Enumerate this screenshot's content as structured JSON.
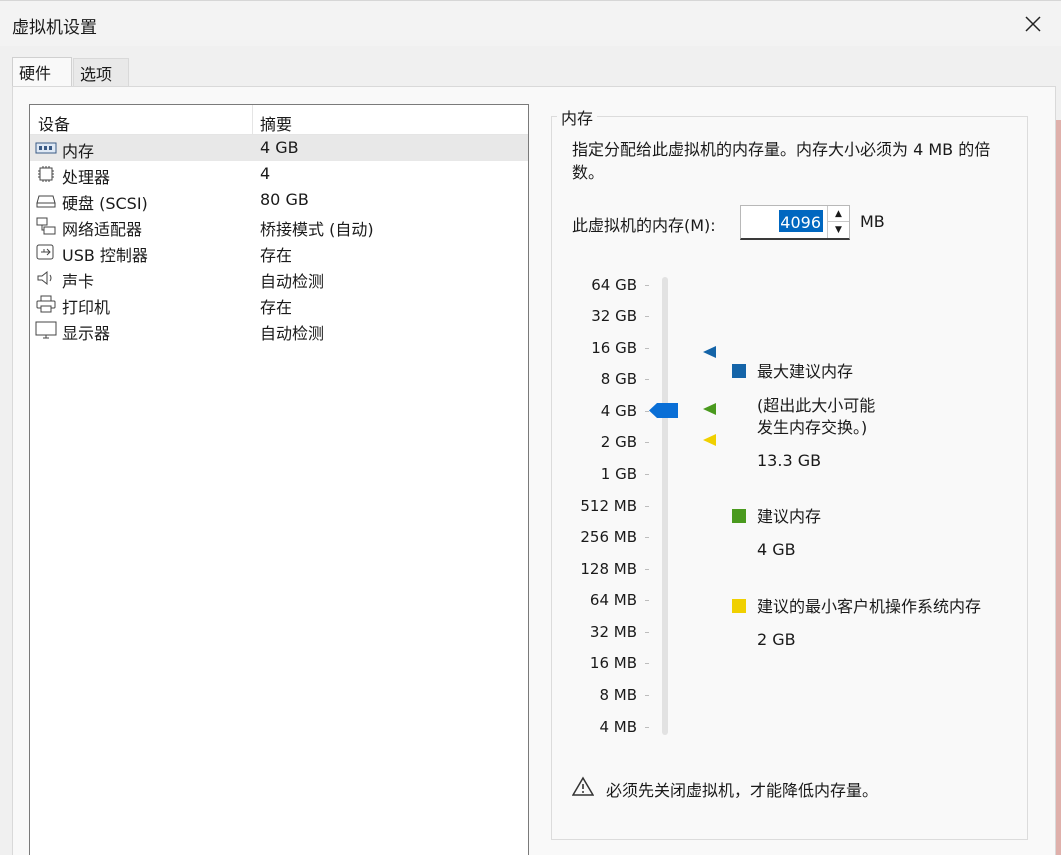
{
  "window": {
    "title": "虚拟机设置"
  },
  "tabs": [
    {
      "label": "硬件"
    },
    {
      "label": "选项"
    }
  ],
  "device_list": {
    "headers": {
      "device": "设备",
      "summary": "摘要"
    },
    "rows": [
      {
        "icon": "memory-icon",
        "name": "内存",
        "summary": "4 GB",
        "selected": true
      },
      {
        "icon": "processor-icon",
        "name": "处理器",
        "summary": "4"
      },
      {
        "icon": "hard-disk-icon",
        "name": "硬盘 (SCSI)",
        "summary": "80 GB"
      },
      {
        "icon": "network-adapter-icon",
        "name": "网络适配器",
        "summary": "桥接模式 (自动)"
      },
      {
        "icon": "usb-icon",
        "name": "USB 控制器",
        "summary": "存在"
      },
      {
        "icon": "sound-card-icon",
        "name": "声卡",
        "summary": "自动检测"
      },
      {
        "icon": "printer-icon",
        "name": "打印机",
        "summary": "存在"
      },
      {
        "icon": "display-icon",
        "name": "显示器",
        "summary": "自动检测"
      }
    ]
  },
  "memory": {
    "group_title": "内存",
    "description": "指定分配给此虚拟机的内存量。内存大小必须为 4 MB 的倍数。",
    "input_label": "此虚拟机的内存(M):",
    "value": "4096",
    "unit": "MB",
    "scale": [
      "64 GB",
      "32 GB",
      "16 GB",
      "8 GB",
      "4 GB",
      "2 GB",
      "1 GB",
      "512 MB",
      "256 MB",
      "128 MB",
      "64 MB",
      "32 MB",
      "16 MB",
      "8 MB",
      "4 MB"
    ],
    "slider_value": "4 GB",
    "legend": {
      "max": {
        "title": "最大建议内存",
        "note1": "(超出此大小可能",
        "note2": "发生内存交换。)",
        "value": "13.3 GB",
        "color": "#1464a8"
      },
      "recommended": {
        "title": "建议内存",
        "value": "4 GB",
        "color": "#4a9a1e"
      },
      "min": {
        "title": "建议的最小客户机操作系统内存",
        "value": "2 GB",
        "color": "#f0d000"
      }
    },
    "warning": "必须先关闭虚拟机，才能降低内存量。"
  }
}
